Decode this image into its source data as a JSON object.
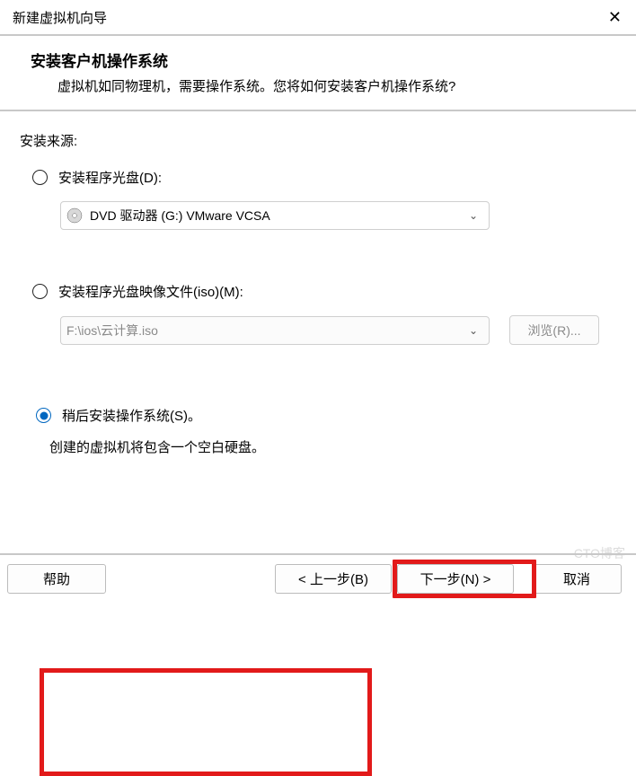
{
  "titlebar": {
    "title": "新建虚拟机向导"
  },
  "header": {
    "title": "安装客户机操作系统",
    "subtitle": "虚拟机如同物理机，需要操作系统。您将如何安装客户机操作系统?"
  },
  "section_label": "安装来源:",
  "option_disc": {
    "label": "安装程序光盘(D):",
    "drive_text": "DVD 驱动器 (G:) VMware VCSA"
  },
  "option_iso": {
    "label": "安装程序光盘映像文件(iso)(M):",
    "path": "F:\\ios\\云计算.iso",
    "browse": "浏览(R)..."
  },
  "option_later": {
    "label": "稍后安装操作系统(S)。",
    "desc": "创建的虚拟机将包含一个空白硬盘。"
  },
  "footer": {
    "help": "帮助",
    "prev": "< 上一步(B)",
    "next": "下一步(N) >",
    "cancel": "取消"
  },
  "watermark": "CTO博客"
}
